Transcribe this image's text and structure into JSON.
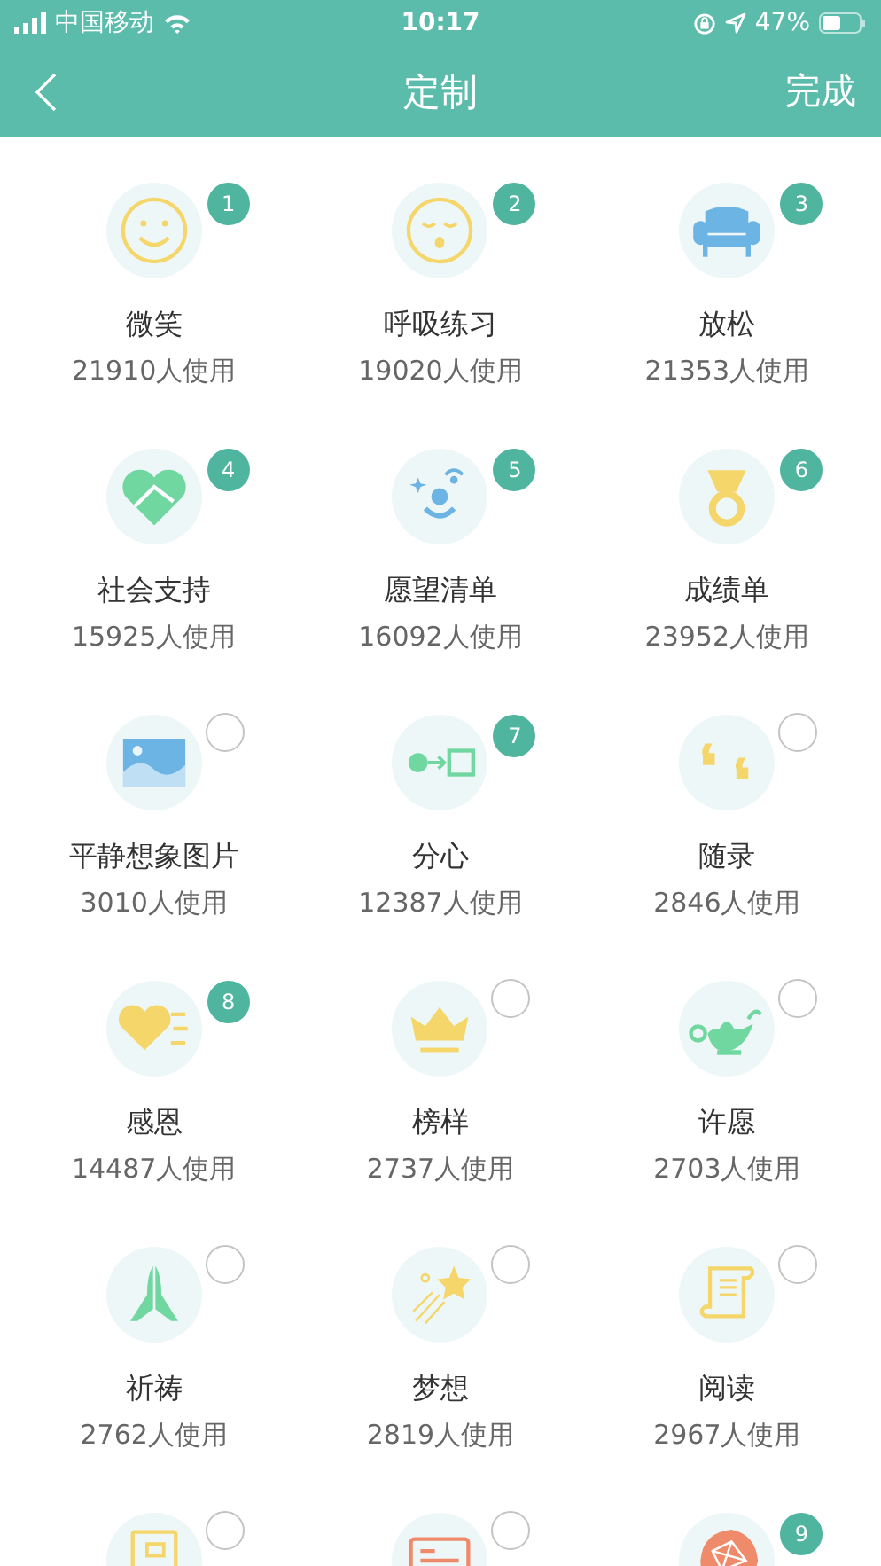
{
  "status_bar": {
    "carrier": "中国移动",
    "time": "10:17",
    "battery": "47%"
  },
  "nav": {
    "title": "定制",
    "action": "完成"
  },
  "items": [
    {
      "name": "微笑",
      "count": "21910人使用",
      "selected": true,
      "order": "1"
    },
    {
      "name": "呼吸练习",
      "count": "19020人使用",
      "selected": true,
      "order": "2"
    },
    {
      "name": "放松",
      "count": "21353人使用",
      "selected": true,
      "order": "3"
    },
    {
      "name": "社会支持",
      "count": "15925人使用",
      "selected": true,
      "order": "4"
    },
    {
      "name": "愿望清单",
      "count": "16092人使用",
      "selected": true,
      "order": "5"
    },
    {
      "name": "成绩单",
      "count": "23952人使用",
      "selected": true,
      "order": "6"
    },
    {
      "name": "平静想象图片",
      "count": "3010人使用",
      "selected": false
    },
    {
      "name": "分心",
      "count": "12387人使用",
      "selected": true,
      "order": "7"
    },
    {
      "name": "随录",
      "count": "2846人使用",
      "selected": false
    },
    {
      "name": "感恩",
      "count": "14487人使用",
      "selected": true,
      "order": "8"
    },
    {
      "name": "榜样",
      "count": "2737人使用",
      "selected": false
    },
    {
      "name": "许愿",
      "count": "2703人使用",
      "selected": false
    },
    {
      "name": "祈祷",
      "count": "2762人使用",
      "selected": false
    },
    {
      "name": "梦想",
      "count": "2819人使用",
      "selected": false
    },
    {
      "name": "阅读",
      "count": "2967人使用",
      "selected": false
    },
    {
      "selected": false
    },
    {
      "selected": false
    },
    {
      "selected": true,
      "order": "9"
    }
  ]
}
